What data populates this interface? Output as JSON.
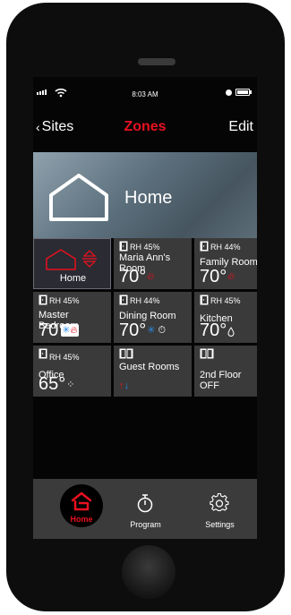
{
  "status_bar": {
    "time": "8:03 AM"
  },
  "nav": {
    "back_label": "Sites",
    "title": "Zones",
    "edit_label": "Edit"
  },
  "hero": {
    "title": "Home"
  },
  "tiles": [
    {
      "name": "Home",
      "type": "home"
    },
    {
      "rh": "RH 45%",
      "name": "Maria Ann's Room",
      "temp": "70°",
      "mode_icon": "flame-icon"
    },
    {
      "rh": "RH 44%",
      "name": "Family Room",
      "temp": "70°",
      "mode_icon": "flame-icon"
    },
    {
      "rh": "RH 45%",
      "name": "Master Bedroom",
      "temp": "70",
      "mode_icon": "snowflake-flame-icon"
    },
    {
      "rh": "RH 44%",
      "name": "Dining Room",
      "temp": "70°",
      "mode_icon": "snowflake-timer-icon"
    },
    {
      "rh": "RH 45%",
      "name": "Kitchen",
      "temp": "70°",
      "mode_icon": "drop-icon"
    },
    {
      "rh": "RH 45%",
      "name": "Office",
      "temp": "65°",
      "mode_icon": "fan-icon"
    },
    {
      "name": "Guest Rooms",
      "mode_icon": "heat-cool-icon"
    },
    {
      "name": "2nd Floor",
      "state": "OFF"
    }
  ],
  "tabbar": {
    "home_label": "Home",
    "program_label": "Program",
    "settings_label": "Settings"
  },
  "colors": {
    "accent": "#e8111f",
    "tile": "#3a3a3a",
    "cool": "#2d8be6"
  }
}
